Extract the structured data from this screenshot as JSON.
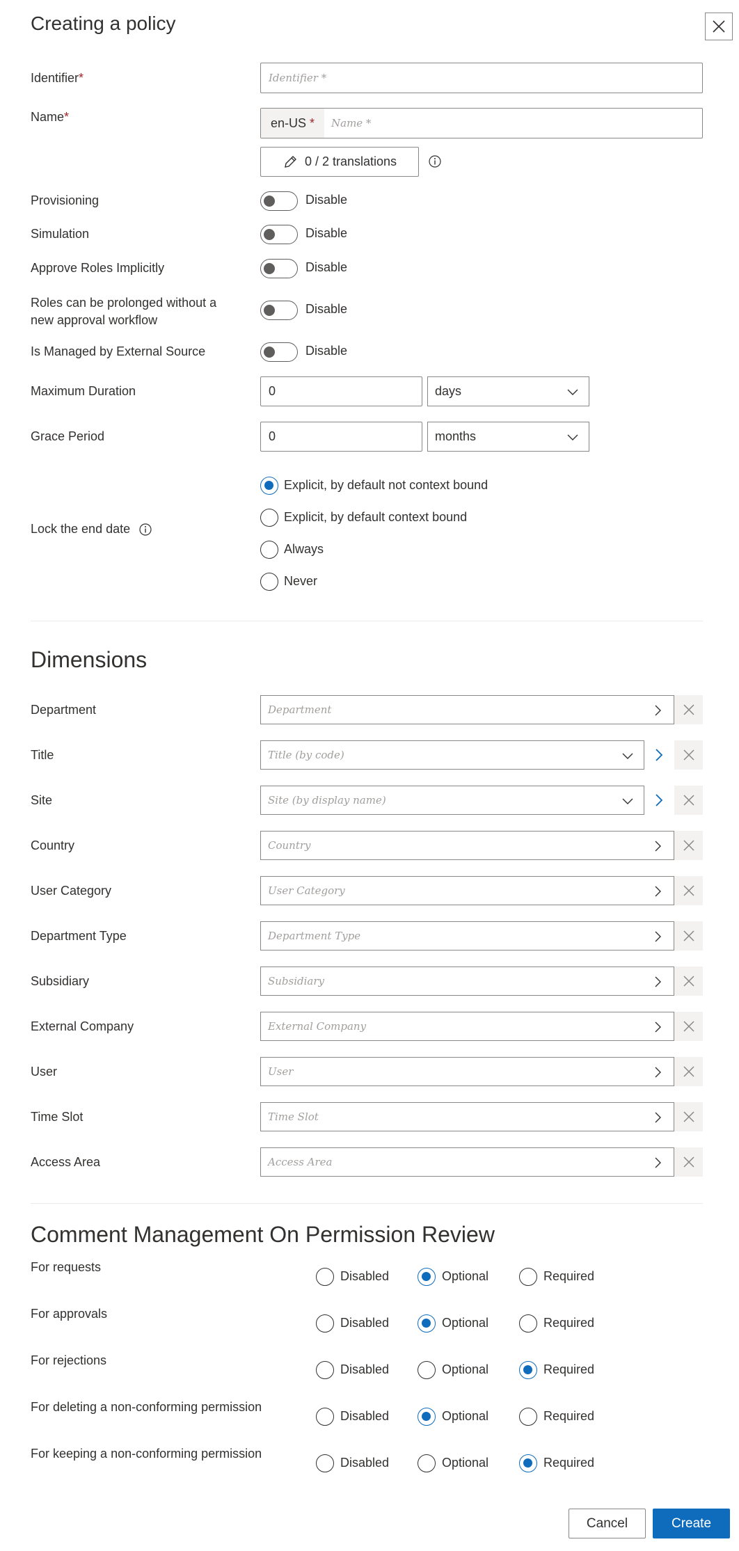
{
  "dialog": {
    "title": "Creating a policy"
  },
  "identifier": {
    "label": "Identifier",
    "required_mark": "*",
    "placeholder": "Identifier *"
  },
  "name": {
    "label": "Name",
    "required_mark": "*",
    "locale": "en-US",
    "locale_mark": "*",
    "placeholder": "Name *",
    "translations": "0 / 2 translations"
  },
  "toggles": [
    {
      "label": "Provisioning",
      "state": "Disable"
    },
    {
      "label": "Simulation",
      "state": "Disable"
    },
    {
      "label": "Approve Roles Implicitly",
      "state": "Disable"
    },
    {
      "label_line1": "Roles can be prolonged without a",
      "label_line2": "new approval workflow",
      "state": "Disable"
    },
    {
      "label": "Is Managed by External Source",
      "state": "Disable"
    }
  ],
  "max_duration": {
    "label": "Maximum Duration",
    "value": "0",
    "unit": "days"
  },
  "grace_period": {
    "label": "Grace Period",
    "value": "0",
    "unit": "months"
  },
  "lock_end_date": {
    "label": "Lock the end date",
    "options": [
      "Explicit, by default not context bound",
      "Explicit, by default context bound",
      "Always",
      "Never"
    ],
    "selected": "Explicit, by default not context bound"
  },
  "dimensions": {
    "heading": "Dimensions",
    "fields": [
      {
        "label": "Department",
        "placeholder": "Department"
      },
      {
        "label": "Title",
        "placeholder": "Title (by code)"
      },
      {
        "label": "Site",
        "placeholder": "Site (by display name)"
      },
      {
        "label": "Country",
        "placeholder": "Country"
      },
      {
        "label": "User Category",
        "placeholder": "User Category"
      },
      {
        "label": "Department Type",
        "placeholder": "Department Type"
      },
      {
        "label": "Subsidiary",
        "placeholder": "Subsidiary"
      },
      {
        "label": "External Company",
        "placeholder": "External Company"
      },
      {
        "label": "User",
        "placeholder": "User"
      },
      {
        "label": "Time Slot",
        "placeholder": "Time Slot"
      },
      {
        "label": "Access Area",
        "placeholder": "Access Area"
      }
    ]
  },
  "comments": {
    "heading": "Comment Management On Permission Review",
    "option_labels": [
      "Disabled",
      "Optional",
      "Required"
    ],
    "rows": [
      {
        "label": "For requests",
        "selected": "Optional"
      },
      {
        "label": "For approvals",
        "selected": "Optional"
      },
      {
        "label": "For rejections",
        "selected": "Required"
      },
      {
        "label": "For deleting a non-conforming permission",
        "selected": "Optional"
      },
      {
        "label": "For keeping a non-conforming permission",
        "selected": "Required"
      }
    ]
  },
  "footer": {
    "cancel": "Cancel",
    "create": "Create"
  },
  "colors": {
    "accent": "#0f6cbd",
    "required": "#a4262c"
  }
}
